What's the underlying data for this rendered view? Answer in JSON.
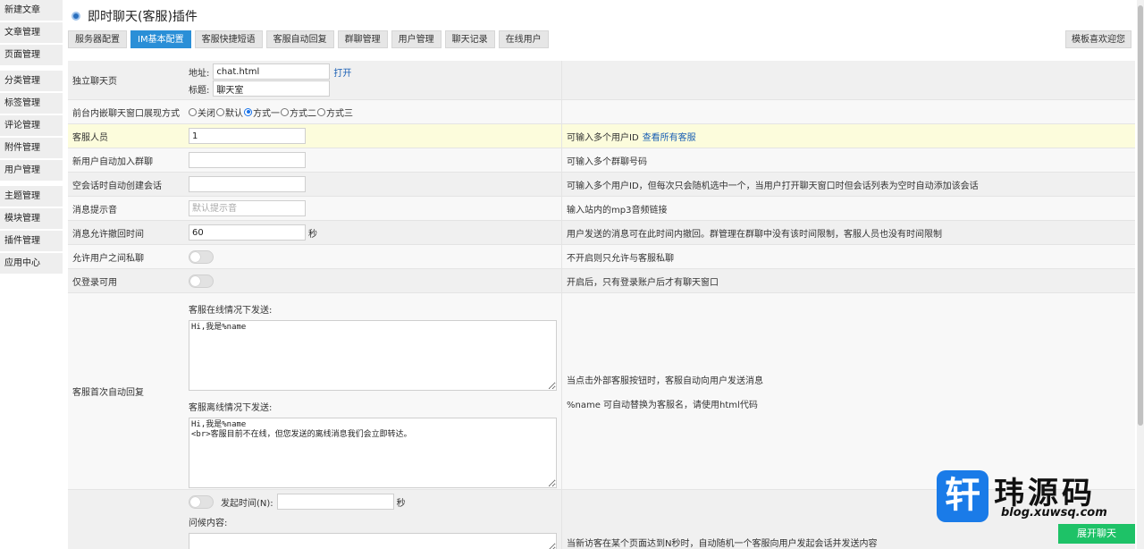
{
  "sidebar": {
    "groups": [
      [
        "新建文章",
        "文章管理",
        "页面管理"
      ],
      [
        "分类管理",
        "标签管理",
        "评论管理",
        "附件管理",
        "用户管理"
      ],
      [
        "主题管理",
        "模块管理",
        "插件管理",
        "应用中心"
      ]
    ]
  },
  "header": {
    "title": "即时聊天(客服)插件"
  },
  "tabs": [
    "服务器配置",
    "IM基本配置",
    "客服快捷短语",
    "客服自动回复",
    "群聊管理",
    "用户管理",
    "聊天记录",
    "在线用户"
  ],
  "active_tab": 1,
  "tab_right": "模板喜欢迎您",
  "rows": {
    "standalone": {
      "label": "独立聊天页",
      "addr_label": "地址:",
      "addr_value": "chat.html",
      "open_link": "打开",
      "title_label": "标题:",
      "title_value": "聊天室"
    },
    "embed_mode": {
      "label": "前台内嵌聊天窗口展现方式",
      "options": [
        "关闭",
        "默认",
        "方式一",
        "方式二",
        "方式三"
      ],
      "selected": 2
    },
    "staff": {
      "label": "客服人员",
      "value": "1",
      "note": "可输入多个用户ID",
      "note_link": "查看所有客服"
    },
    "auto_join": {
      "label": "新用户自动加入群聊",
      "value": "",
      "note": "可输入多个群聊号码"
    },
    "auto_create": {
      "label": "空会话时自动创建会话",
      "value": "",
      "note": "可输入多个用户ID，但每次只会随机选中一个，当用户打开聊天窗口时但会话列表为空时自动添加该会话"
    },
    "sound": {
      "label": "消息提示音",
      "placeholder": "默认提示音",
      "note": "输入站内的mp3音频链接"
    },
    "recall": {
      "label": "消息允许撤回时间",
      "value": "60",
      "suffix": "秒",
      "note": "用户发送的消息可在此时间内撤回。群管理在群聊中没有该时间限制，客服人员也没有时间限制"
    },
    "private_chat": {
      "label": "允许用户之间私聊",
      "note": "不开启则只允许与客服私聊"
    },
    "login_only": {
      "label": "仅登录可用",
      "note": "开启后，只有登录账户后才有聊天窗口"
    },
    "first_reply": {
      "label": "客服首次自动回复",
      "online_label": "客服在线情况下发送:",
      "online_value": "Hi,我是%name",
      "offline_label": "客服离线情况下发送:",
      "offline_value": "Hi,我是%name\n<br>客服目前不在线，但您发送的离线消息我们会立即转达。",
      "note1": "当点击外部客服按钮时，客服自动向用户发送消息",
      "note2": "%name 可自动替换为客服名，请使用html代码"
    },
    "greeting": {
      "time_label": "发起时间(N):",
      "suffix": "秒",
      "content_label": "问候内容:",
      "note": "当新访客在某个页面达到N秒时，自动随机一个客服向用户发起会话并发送内容"
    }
  },
  "watermark": {
    "glyph": "轩",
    "text": "玮源码",
    "url": "blog.xuwsq.com"
  },
  "chat_button": "展开聊天",
  "colors": {
    "accent": "#2a8fd7",
    "chat_green": "#1ec267",
    "highlight_row": "#fcfcdc"
  }
}
